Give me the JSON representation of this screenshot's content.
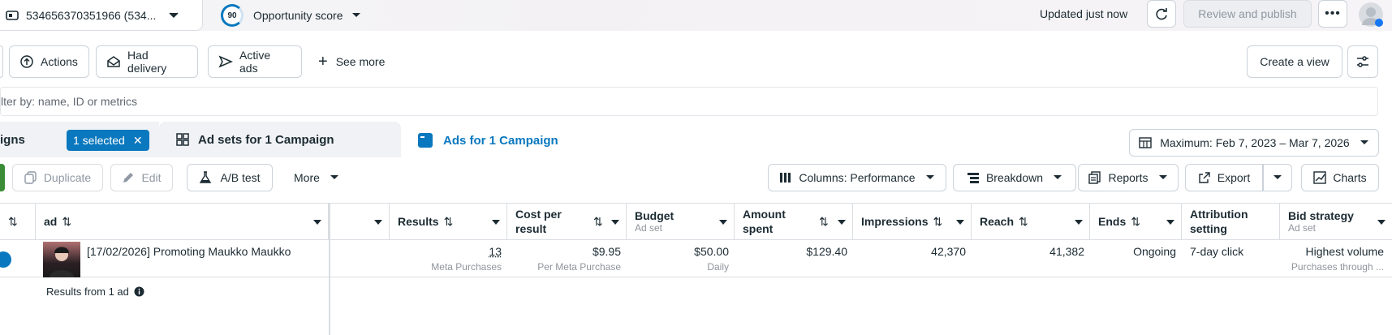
{
  "topbar": {
    "account_label": "534656370351966 (534...",
    "opportunity_score": "90",
    "opportunity_label": "Opportunity score",
    "updated_text": "Updated just now",
    "review_publish_label": "Review and publish"
  },
  "filters": {
    "chips": [
      {
        "label": "Actions",
        "icon": "upload-circle-icon"
      },
      {
        "label": "Had delivery",
        "icon": "envelope-icon"
      },
      {
        "label": "Active ads",
        "icon": "send-icon"
      }
    ],
    "see_more_label": "See more",
    "create_view_label": "Create a view"
  },
  "search": {
    "placeholder": "lter by: name, ID or metrics"
  },
  "tabs": {
    "campaigns_label": "igns",
    "selected_label": "1 selected",
    "adsets_label": "Ad sets for 1 Campaign",
    "ads_label": "Ads for 1 Campaign",
    "date_range_label": "Maximum: Feb 7, 2023 – Mar 7, 2026"
  },
  "toolbar": {
    "duplicate_label": "Duplicate",
    "edit_label": "Edit",
    "ab_test_label": "A/B test",
    "more_label": "More",
    "columns_label": "Columns: Performance",
    "breakdown_label": "Breakdown",
    "reports_label": "Reports",
    "export_label": "Export",
    "charts_label": "Charts"
  },
  "table": {
    "headers": {
      "ad": "ad",
      "results": "Results",
      "cost_per_result": "Cost per result",
      "budget": "Budget",
      "budget_sub": "Ad set",
      "amount_spent": "Amount spent",
      "impressions": "Impressions",
      "reach": "Reach",
      "ends": "Ends",
      "attribution": "Attribution setting",
      "bid_strategy": "Bid strategy",
      "bid_strategy_sub": "Ad set"
    },
    "row": {
      "name": "[17/02/2026] Promoting Maukko Maukko",
      "results": "13",
      "results_sub": "Meta Purchases",
      "cost_per_result": "$9.95",
      "cost_sub": "Per Meta Purchase",
      "budget": "$50.00",
      "budget_sub": "Daily",
      "amount_spent": "$129.40",
      "impressions": "42,370",
      "reach": "41,382",
      "ends": "Ongoing",
      "attribution": "7-day click",
      "bid_strategy": "Highest volume",
      "bid_sub": "Purchases through ..."
    },
    "footer_label": "Results from 1 ad"
  },
  "colors": {
    "accent": "#0a78be",
    "text": "#1c2b33",
    "status_dot": "#0a78be"
  }
}
